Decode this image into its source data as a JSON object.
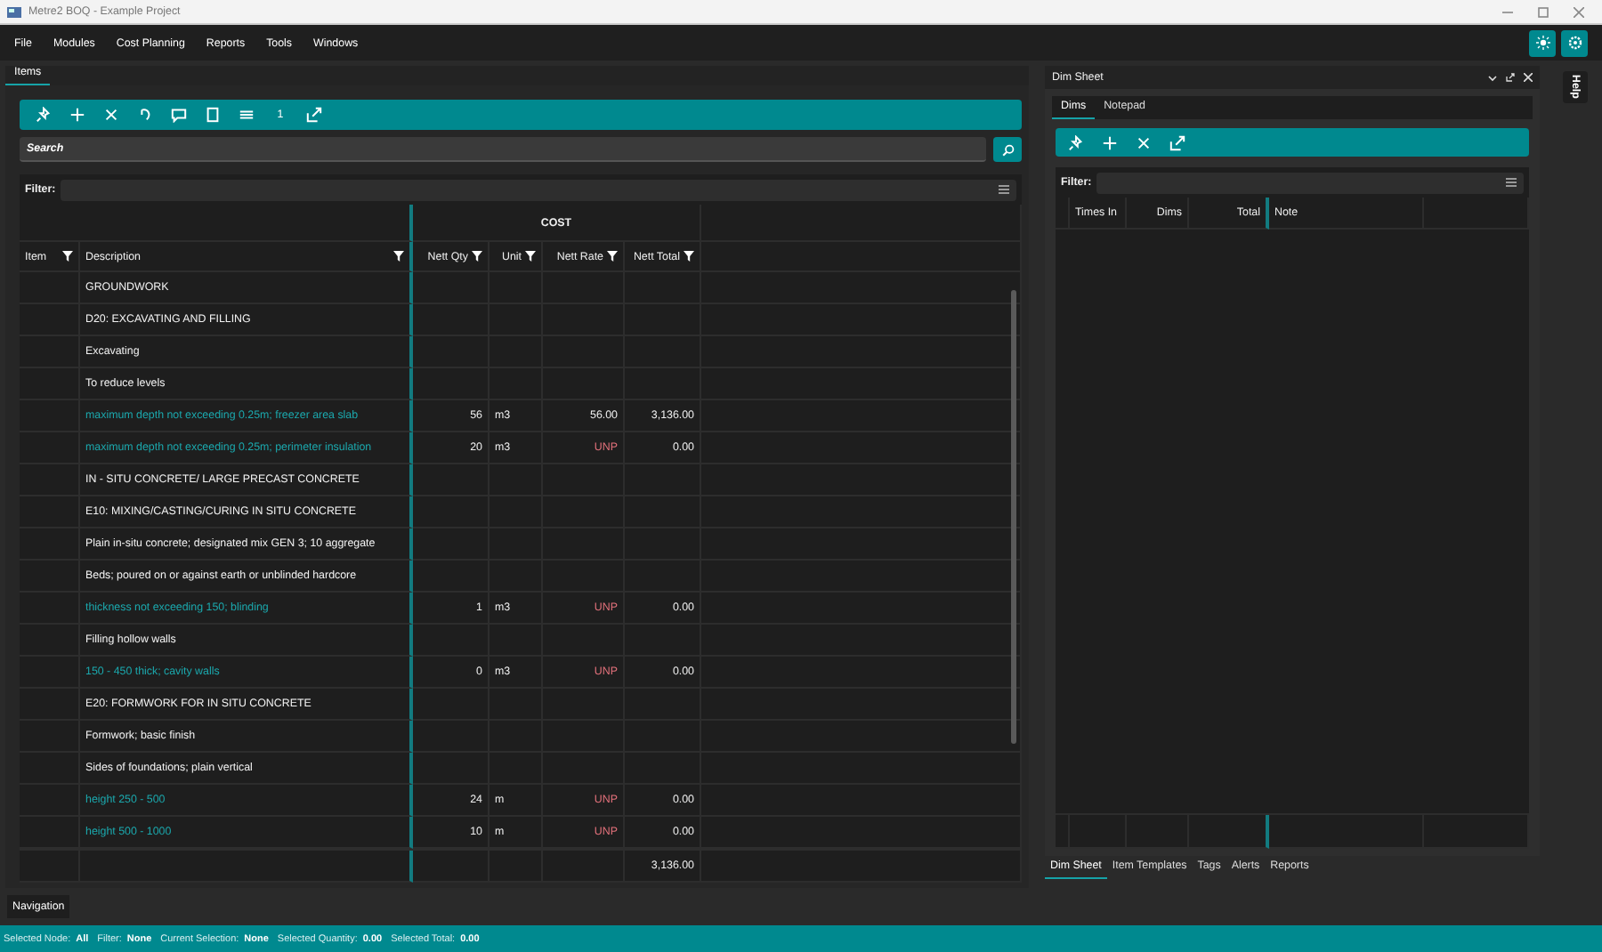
{
  "window": {
    "title": "Metre2 BOQ - Example Project"
  },
  "menu": [
    "File",
    "Modules",
    "Cost Planning",
    "Reports",
    "Tools",
    "Windows"
  ],
  "items_panel": {
    "tab": "Items",
    "toolbar_count": "1",
    "search": {
      "placeholder": "Search"
    },
    "filter_label": "Filter:",
    "group_header": "COST",
    "columns": [
      {
        "label": "Item",
        "filter": true
      },
      {
        "label": "Description",
        "filter": true
      },
      {
        "label": "Nett Qty",
        "filter": true
      },
      {
        "label": "Unit",
        "filter": true
      },
      {
        "label": "Nett Rate",
        "filter": true
      },
      {
        "label": "Nett Total",
        "filter": true
      }
    ],
    "rows": [
      {
        "kind": "heading",
        "description": "GROUNDWORK"
      },
      {
        "kind": "heading",
        "description": "D20: EXCAVATING AND FILLING"
      },
      {
        "kind": "heading",
        "description": "Excavating"
      },
      {
        "kind": "heading",
        "description": "To reduce levels"
      },
      {
        "kind": "item",
        "description": "maximum depth not exceeding 0.25m; freezer area slab",
        "qty": "56",
        "unit": "m3",
        "rate": "56.00",
        "priced": true,
        "total": "3,136.00"
      },
      {
        "kind": "item",
        "description": "maximum depth not exceeding 0.25m; perimeter insulation",
        "qty": "20",
        "unit": "m3",
        "rate": "UNP",
        "priced": false,
        "total": "0.00"
      },
      {
        "kind": "heading",
        "description": "IN - SITU CONCRETE/ LARGE PRECAST CONCRETE"
      },
      {
        "kind": "heading",
        "description": "E10: MIXING/CASTING/CURING IN SITU CONCRETE"
      },
      {
        "kind": "heading",
        "description": "Plain in-situ concrete; designated mix GEN 3; 10 aggregate"
      },
      {
        "kind": "heading",
        "description": "Beds; poured on or against earth or unblinded hardcore"
      },
      {
        "kind": "item",
        "description": "thickness not exceeding 150; blinding",
        "qty": "1",
        "unit": "m3",
        "rate": "UNP",
        "priced": false,
        "total": "0.00"
      },
      {
        "kind": "heading",
        "description": "Filling hollow walls"
      },
      {
        "kind": "item",
        "description": "150 - 450 thick; cavity walls",
        "qty": "0",
        "unit": "m3",
        "rate": "UNP",
        "priced": false,
        "total": "0.00"
      },
      {
        "kind": "heading",
        "description": "E20: FORMWORK  FOR IN SITU CONCRETE"
      },
      {
        "kind": "heading",
        "description": "Formwork; basic finish"
      },
      {
        "kind": "heading",
        "description": "Sides of foundations; plain vertical"
      },
      {
        "kind": "item",
        "description": "height 250 - 500",
        "qty": "24",
        "unit": "m",
        "rate": "UNP",
        "priced": false,
        "total": "0.00"
      },
      {
        "kind": "item",
        "description": "height 500 - 1000",
        "qty": "10",
        "unit": "m",
        "rate": "UNP",
        "priced": false,
        "total": "0.00"
      }
    ],
    "footer_total": "3,136.00"
  },
  "dim_sheet": {
    "title": "Dim Sheet",
    "tabs": [
      {
        "label": "Dims",
        "selected": true
      },
      {
        "label": "Notepad",
        "selected": false
      }
    ],
    "filter_label": "Filter:",
    "columns": [
      "Times In",
      "Dims",
      "Total",
      "Note"
    ]
  },
  "bottom_tabs": [
    {
      "label": "Dim Sheet",
      "selected": true
    },
    {
      "label": "Item Templates",
      "selected": false
    },
    {
      "label": "Tags",
      "selected": false
    },
    {
      "label": "Alerts",
      "selected": false
    },
    {
      "label": "Reports",
      "selected": false
    }
  ],
  "help_tab": "Help",
  "navigation": "Navigation",
  "status_bar": [
    {
      "label": "Selected Node:",
      "value": "All"
    },
    {
      "label": "Filter:",
      "value": "None"
    },
    {
      "label": "Current Selection:",
      "value": "None"
    },
    {
      "label": "Selected Quantity:",
      "value": "0.00"
    },
    {
      "label": "Selected Total:",
      "value": "0.00"
    }
  ]
}
